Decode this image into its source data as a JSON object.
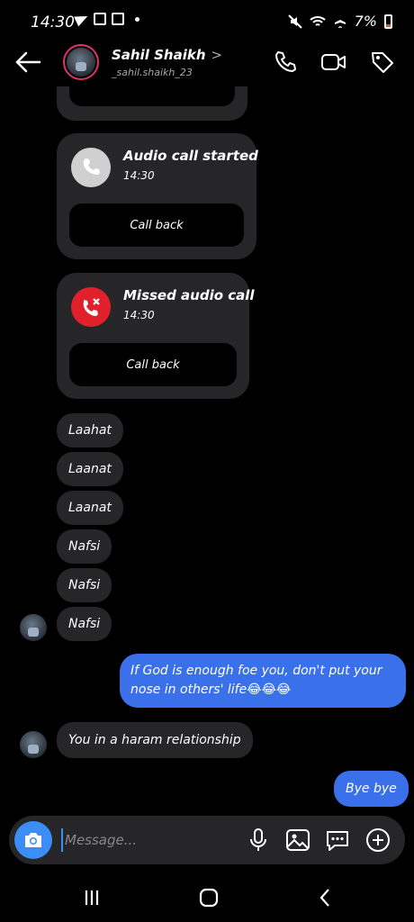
{
  "status_bar": {
    "time": "14:30",
    "battery": "7%"
  },
  "header": {
    "name": "Sahil Shaikh",
    "chevron": ">",
    "username": "_sahil.shaikh_23"
  },
  "calls": [
    {
      "title": "Audio call started",
      "time": "14:30",
      "button": "Call back",
      "kind": "started",
      "color": "#d0d0d0"
    },
    {
      "title": "Missed audio call",
      "time": "14:30",
      "button": "Call back",
      "kind": "missed",
      "color": "#e0202b"
    }
  ],
  "messages": [
    {
      "text": "Laahat",
      "from": "them"
    },
    {
      "text": "Laanat",
      "from": "them"
    },
    {
      "text": "Laanat",
      "from": "them"
    },
    {
      "text": "Nafsi",
      "from": "them"
    },
    {
      "text": "Nafsi",
      "from": "them"
    },
    {
      "text": "Nafsi",
      "from": "them"
    },
    {
      "text": "If God is enough foe you,  don't put your nose in others' life😂😂😂",
      "from": "me"
    },
    {
      "text": "You in a haram relationship",
      "from": "them"
    },
    {
      "text": "Bye bye",
      "from": "me"
    }
  ],
  "composer": {
    "placeholder": "Message..."
  },
  "colors": {
    "accent": "#3a8ef6",
    "sent_bubble": "#3a70e9",
    "received_bubble": "#262629",
    "missed": "#e0202b"
  }
}
